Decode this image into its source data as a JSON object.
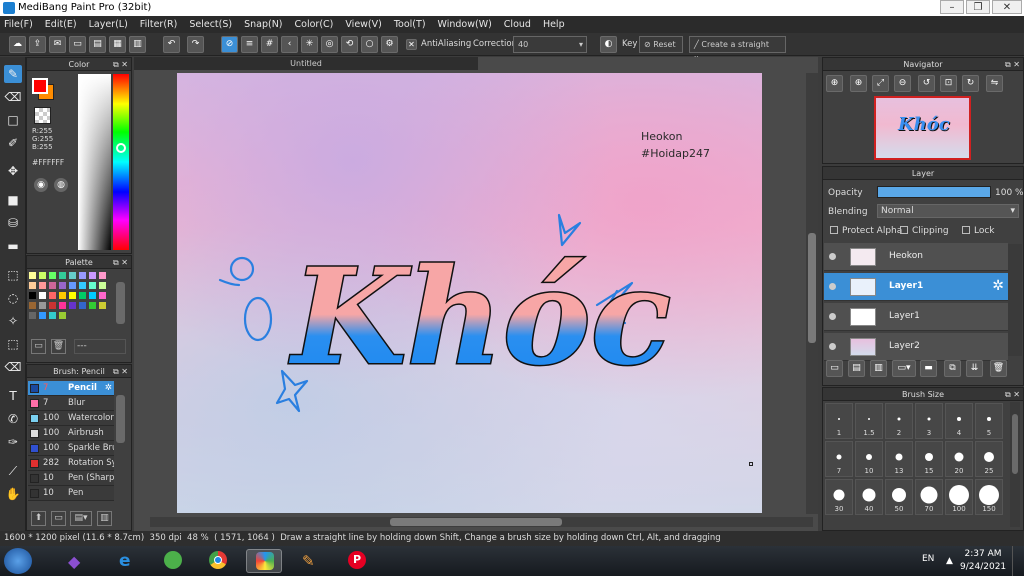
{
  "window": {
    "title": "MediBang Paint Pro (32bit)"
  },
  "menu": [
    "File(F)",
    "Edit(E)",
    "Layer(L)",
    "Filter(R)",
    "Select(S)",
    "Snap(N)",
    "Color(C)",
    "View(V)",
    "Tool(T)",
    "Window(W)",
    "Cloud",
    "Help"
  ],
  "toolbar": {
    "antialiasing_label": "AntiAliasing",
    "correction_label": "Correction",
    "correction_value": "40",
    "key_label": "Key",
    "reset_label": "Reset",
    "straight_line_label": "Create a straight line"
  },
  "color_panel": {
    "title": "Color",
    "r": "R:255",
    "g": "G:255",
    "b": "B:255",
    "hex": "#FFFFFF",
    "primary_color": "#ff0000",
    "secondary_color": "#ff8c00"
  },
  "palette_panel": {
    "title": "Palette",
    "page_label": "---",
    "swatches": [
      "#ffff99",
      "#ccff66",
      "#66ff66",
      "#33cc99",
      "#66cccc",
      "#9999ff",
      "#cc99ff",
      "#ff99cc",
      "#ffcc99",
      "#ff9999",
      "#cc6699",
      "#9966cc",
      "#6699ff",
      "#33ccff",
      "#66ffcc",
      "#ccff99",
      "#000000",
      "#ffffff",
      "#ff6666",
      "#ffcc00",
      "#ffff00",
      "#00cc66",
      "#00ccff",
      "#ff66cc",
      "#996633",
      "#999999",
      "#cc3333",
      "#ff3399",
      "#6633cc",
      "#3366cc",
      "#33cc33",
      "#cccc33",
      "#666666",
      "#3399ff",
      "#33cccc",
      "#99cc33"
    ]
  },
  "brush_panel": {
    "title": "Brush: Pencil",
    "brushes": [
      {
        "size": "7",
        "name": "Pencil",
        "color": "#1a4aa0",
        "selected": true
      },
      {
        "size": "7",
        "name": "Blur",
        "color": "#ff6fa8",
        "selected": false
      },
      {
        "size": "100",
        "name": "Watercolor",
        "color": "#7ad0f0",
        "selected": false
      },
      {
        "size": "100",
        "name": "Airbrush",
        "color": "#dddddd",
        "selected": false
      },
      {
        "size": "100",
        "name": "Sparkle Brush",
        "color": "#3050d0",
        "selected": false
      },
      {
        "size": "282",
        "name": "Rotation Sy",
        "color": "#e03030",
        "selected": false
      },
      {
        "size": "10",
        "name": "Pen (Sharp)",
        "color": "#333333",
        "selected": false
      },
      {
        "size": "10",
        "name": "Pen",
        "color": "#333333",
        "selected": false
      }
    ]
  },
  "document": {
    "tab_title": "Untitled",
    "credit_line1": "Heokon",
    "credit_line2": "#Hoidap247",
    "artwork_text": "Khóc"
  },
  "navigator": {
    "title": "Navigator"
  },
  "layer_panel": {
    "title": "Layer",
    "opacity_label": "Opacity",
    "opacity_value": "100 %",
    "opacity_fraction": 1.0,
    "blending_label": "Blending",
    "blending_value": "Normal",
    "protect_alpha_label": "Protect Alpha",
    "clipping_label": "Clipping",
    "lock_label": "Lock",
    "layers": [
      {
        "name": "Heokon",
        "selected": false
      },
      {
        "name": "Layer1",
        "selected": true
      },
      {
        "name": "Layer1",
        "selected": false
      },
      {
        "name": "Layer2",
        "selected": false
      }
    ]
  },
  "brush_size_panel": {
    "title": "Brush Size",
    "sizes": [
      "1",
      "1.5",
      "2",
      "3",
      "4",
      "5",
      "7",
      "10",
      "13",
      "15",
      "20",
      "25",
      "30",
      "40",
      "50",
      "70",
      "100",
      "150"
    ]
  },
  "status": {
    "image_size": "1600 * 1200 pixel",
    "physical_size": "(11.6 * 8.7cm)",
    "dpi": "350 dpi",
    "zoom": "48 %",
    "cursor": "( 1571, 1064 )",
    "hint": "Draw a straight line by holding down Shift, Change a brush size by holding down Ctrl, Alt, and dragging"
  },
  "taskbar": {
    "lang": "EN",
    "time": "2:37 AM",
    "date": "9/24/2021"
  }
}
